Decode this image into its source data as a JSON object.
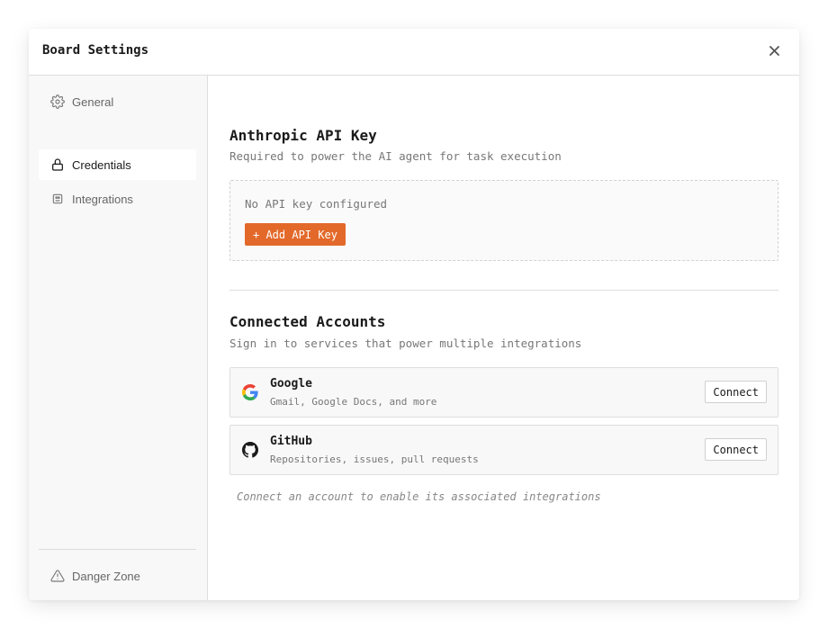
{
  "modal": {
    "title": "Board Settings"
  },
  "sidebar": {
    "items": [
      {
        "label": "General",
        "icon": "gear-icon",
        "active": false
      },
      {
        "label": "Credentials",
        "icon": "lock-icon",
        "active": true
      },
      {
        "label": "Integrations",
        "icon": "integration-icon",
        "active": false
      }
    ],
    "danger": {
      "label": "Danger Zone",
      "icon": "warning-triangle-icon"
    }
  },
  "api_key": {
    "title": "Anthropic API Key",
    "subtitle": "Required to power the AI agent for task execution",
    "empty_text": "No API key configured",
    "add_label": "+ Add API Key"
  },
  "accounts": {
    "title": "Connected Accounts",
    "subtitle": "Sign in to services that power multiple integrations",
    "items": [
      {
        "name": "Google",
        "description": "Gmail, Google Docs, and more",
        "icon": "google-icon",
        "action": "Connect"
      },
      {
        "name": "GitHub",
        "description": "Repositories, issues, pull requests",
        "icon": "github-icon",
        "action": "Connect"
      }
    ],
    "hint": "Connect an account to enable its associated integrations"
  },
  "colors": {
    "accent": "#e3692a",
    "sidebar_bg": "#f8f8f8",
    "border": "#dedede"
  }
}
